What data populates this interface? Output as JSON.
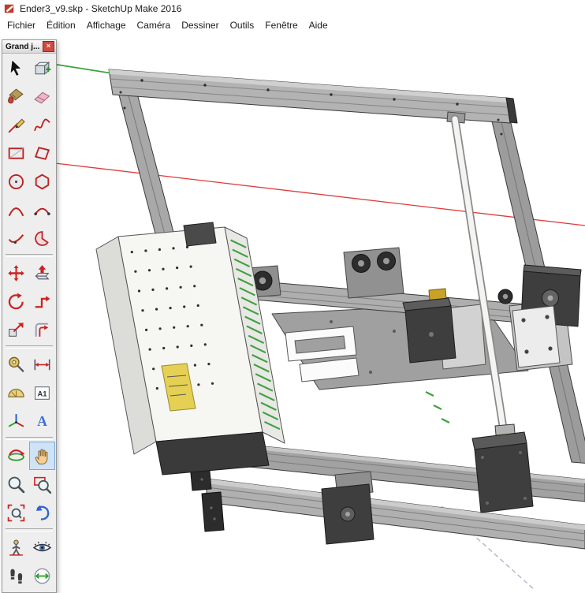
{
  "window": {
    "title": "Ender3_v9.skp - SketchUp Make 2016"
  },
  "menu_bar": {
    "items": [
      "Fichier",
      "Édition",
      "Affichage",
      "Caméra",
      "Dessiner",
      "Outils",
      "Fenêtre",
      "Aide"
    ]
  },
  "tool_palette": {
    "title": "Grand j...",
    "close_label": "×",
    "selected_tool": "pan",
    "groups": [
      {
        "tools": [
          "select",
          "make-component",
          "paint-bucket",
          "eraser",
          "line",
          "freehand",
          "rectangle",
          "rotated-rectangle",
          "circle",
          "polygon",
          "arc",
          "two-point-arc",
          "three-point-arc",
          "pie"
        ]
      },
      {
        "tools": [
          "move",
          "push-pull",
          "rotate",
          "follow-me",
          "scale",
          "offset"
        ]
      },
      {
        "tools": [
          "tape-measure",
          "dimension",
          "protractor",
          "text",
          "axes",
          "3d-text"
        ]
      },
      {
        "tools": [
          "orbit",
          "pan",
          "zoom",
          "zoom-window",
          "zoom-extents",
          "previous"
        ]
      },
      {
        "tools": [
          "position-camera",
          "look-around",
          "walk",
          "section-plane"
        ]
      }
    ]
  },
  "colors": {
    "axis_red": "#e03a3a",
    "axis_green": "#3aa33a",
    "selected_tool_bg": "#cfe3f6",
    "close_button_red": "#cf4a41",
    "psu_label_yellow": "#e6d054",
    "brass": "#c9a227"
  }
}
